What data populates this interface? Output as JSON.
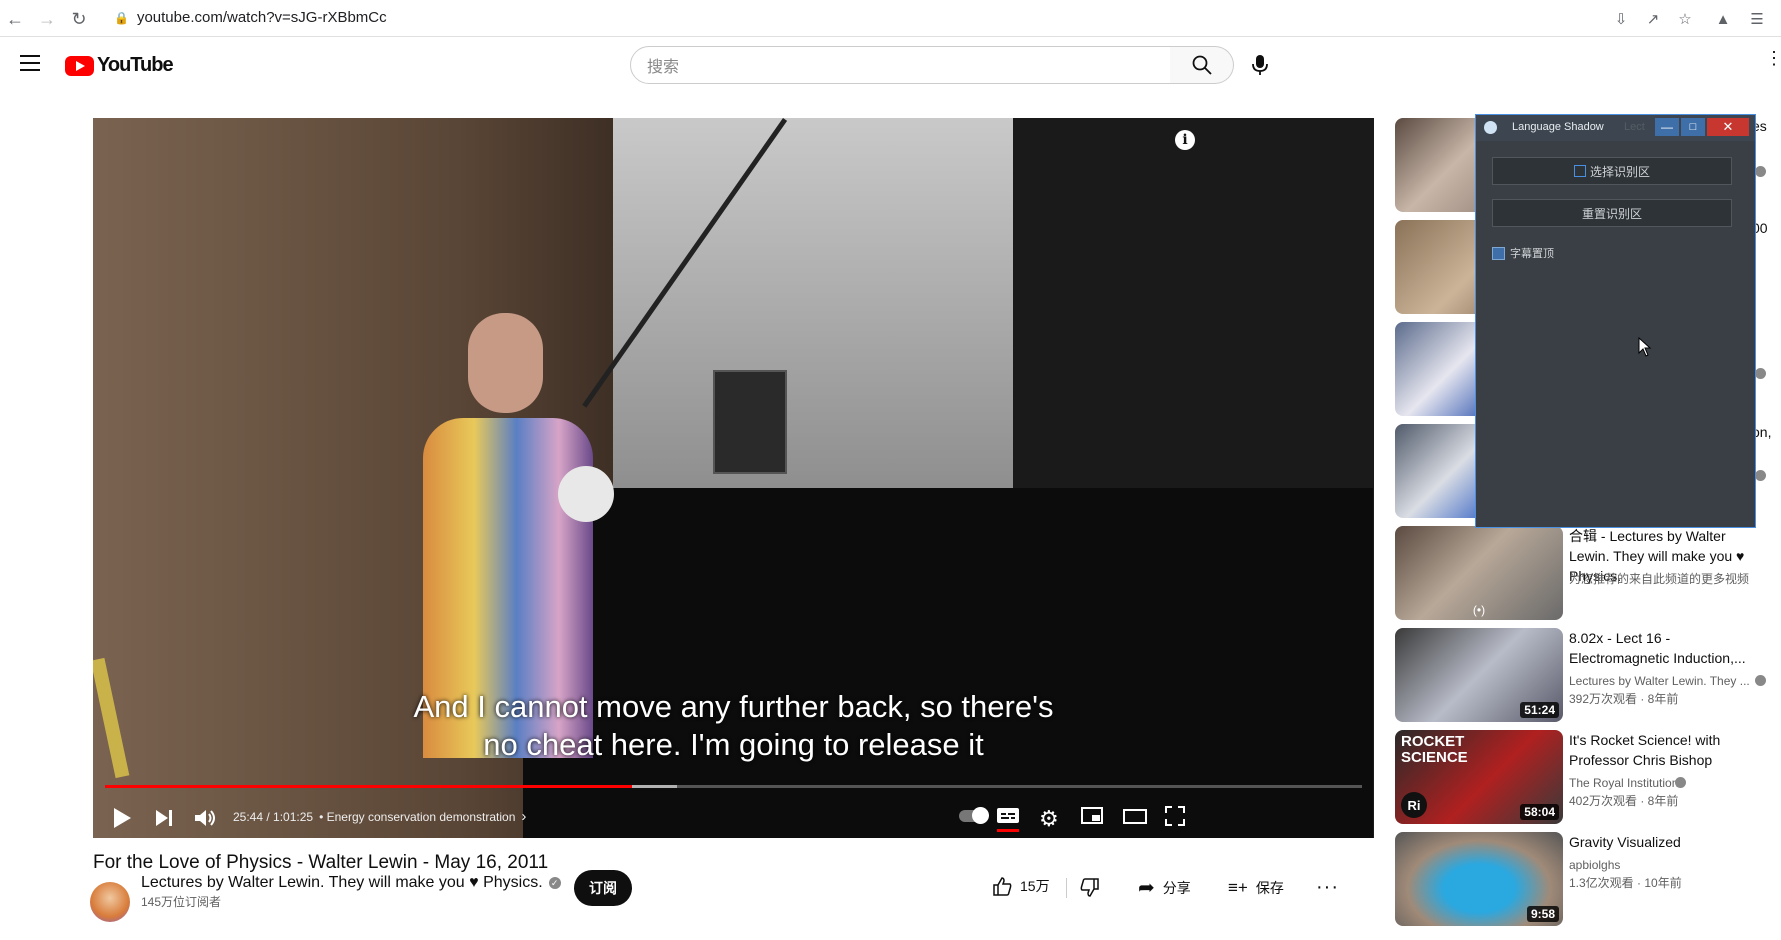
{
  "browser": {
    "url": "youtube.com/watch?v=sJG-rXBbmCc"
  },
  "header": {
    "logo_text": "YouTube",
    "search_placeholder": "搜索"
  },
  "player": {
    "subtitle_line1": "And I cannot move any further back, so there's",
    "subtitle_line2": "no cheat here. I'm going to release it",
    "time": "25:44 / 1:01:25",
    "chapter": "• Energy conservation demonstration",
    "chapter_arrow": "›",
    "progress_fraction": 0.419,
    "buffered_fraction": 0.455
  },
  "video": {
    "title": "For the Love of Physics - Walter Lewin - May 16, 2011",
    "channel": "Lectures by Walter Lewin. They will make you ♥ Physics.",
    "subscribers": "145万位订阅者",
    "subscribe_label": "订阅",
    "likes": "15万",
    "share_label": "分享",
    "save_label": "保存"
  },
  "language_window": {
    "title": "Language Shadow",
    "title_overlay": "Lect",
    "select_region": "选择识别区",
    "reset_region": "重置识别区",
    "subtitle_top": "字幕置顶"
  },
  "sidebar": {
    "partial_right": [
      "es",
      "00",
      "on,"
    ],
    "items": [
      {
        "title": "合辑 - Lectures by Walter Lewin. They will make you ♥ Physics.",
        "meta1": "为您推荐的来自此频道的更多视频",
        "meta2": "",
        "duration": "(•)"
      },
      {
        "title": "8.02x - Lect 16 - Electromagnetic Induction,...",
        "meta1": "Lectures by Walter Lewin. They ...",
        "meta2": "392万次观看 · 8年前",
        "duration": "51:24"
      },
      {
        "title": "It's Rocket Science! with Professor Chris Bishop",
        "meta1": "The Royal Institution",
        "meta2": "402万次观看 · 8年前",
        "duration": "58:04"
      },
      {
        "title": "Gravity Visualized",
        "meta1": "apbiolghs",
        "meta2": "1.3亿次观看 · 10年前",
        "duration": "9:58"
      }
    ],
    "rocket_text": "ROCKET SCIENCE",
    "ri_badge": "Ri"
  },
  "colors": {
    "progress_red": "#ff0000",
    "yt_red": "#ff0000",
    "window_border": "#4a90e2"
  }
}
